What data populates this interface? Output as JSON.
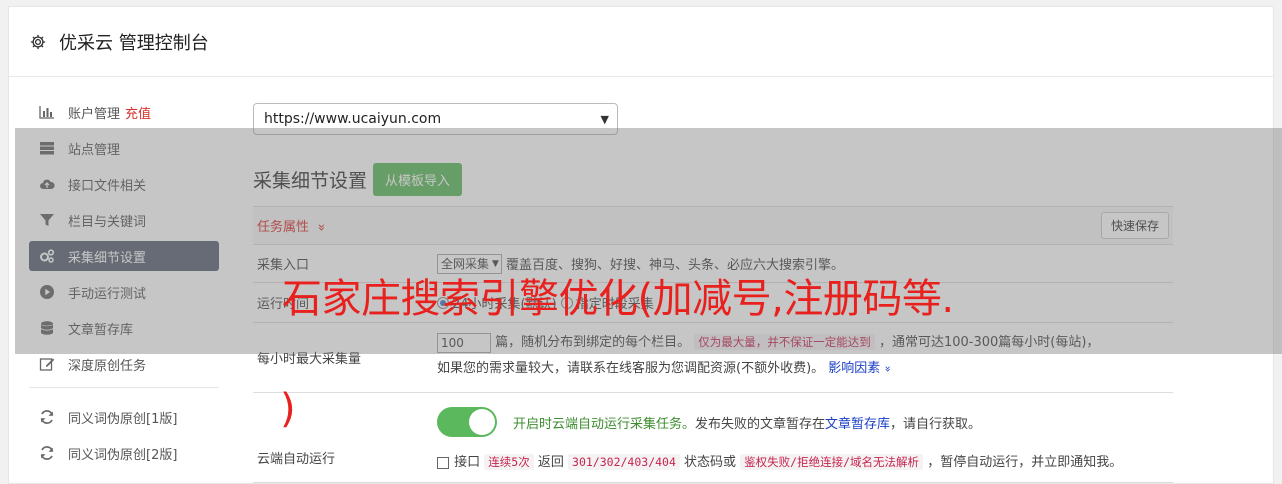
{
  "header": {
    "title": "优采云 管理控制台",
    "icon": "gear-icon"
  },
  "sidebar": {
    "items": [
      {
        "label": "账户管理",
        "extra": "充值",
        "icon": "bar-chart-icon"
      },
      {
        "label": "站点管理",
        "icon": "server-icon"
      },
      {
        "label": "接口文件相关",
        "icon": "cloud-upload-icon"
      },
      {
        "label": "栏目与关键词",
        "icon": "filter-icon"
      },
      {
        "label": "采集细节设置",
        "icon": "gears-icon",
        "active": true
      },
      {
        "label": "手动运行测试",
        "icon": "play-circle-icon"
      },
      {
        "label": "文章暂存库",
        "icon": "database-icon"
      },
      {
        "label": "深度原创任务",
        "icon": "edit-icon"
      },
      {
        "label": "同义词伪原创[1版]",
        "icon": "refresh-icon"
      },
      {
        "label": "同义词伪原创[2版]",
        "icon": "refresh-icon"
      }
    ]
  },
  "main": {
    "site_select": "https://www.ucaiyun.com",
    "section_title": "采集细节设置",
    "import_button": "从模板导入",
    "task_attr": "任务属性",
    "task_attr_caret": "»",
    "quick_save": "快速保存",
    "rows": {
      "entry": {
        "label": "采集入口",
        "select": "全网采集",
        "desc": "覆盖百度、搜狗、好搜、神马、头条、必应六大搜索引擎。"
      },
      "runtime": {
        "label": "运行时间",
        "opt1": "24小时采集(默认)",
        "opt2": "指定时段采集"
      },
      "max": {
        "label": "每小时最大采集量",
        "value": "100",
        "t1": "篇，随机分布到绑定的每个栏目。",
        "code1": "仅为最大量，并不保证一定能达到",
        "t2": "，通常可达100-300篇每小时(每站)，",
        "t3": "如果您的需求量较大，请联系在线客服为您调配资源(不额外收费)。",
        "link": "影响因素",
        "link_caret": "»"
      },
      "auto": {
        "label": "云端自动运行",
        "green": "开启时云端自动运行采集任务。",
        "t1": "发布失败的文章暂存在",
        "link": "文章暂存库",
        "t2": "，请自行获取。",
        "cb_label": "接口",
        "code1": "连续5次",
        "t3": "返回",
        "code2": "301/302/403/404",
        "t4": "状态码或",
        "code3": "鉴权失败/拒绝连接/域名无法解析",
        "t5": "，暂停自动运行，并立即通知我。"
      }
    }
  },
  "watermark": {
    "line1": "石家庄搜索引擎优化(加减号,注册码等.",
    "line2": ")"
  },
  "colors": {
    "accent_green": "#5cb85c",
    "active_nav": "#5a6374",
    "red": "#d9302c",
    "watermark": "#e8211e"
  }
}
